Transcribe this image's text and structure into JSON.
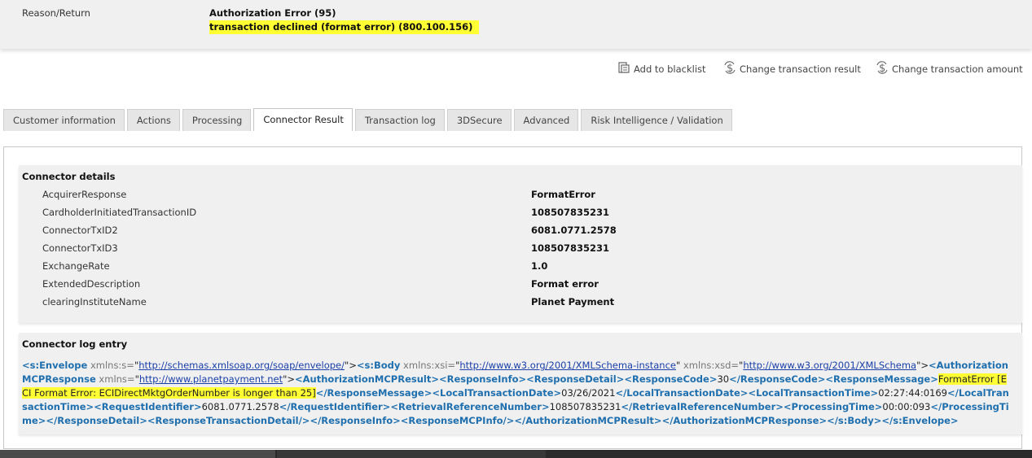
{
  "reason": {
    "label": "Reason/Return",
    "title": "Authorization Error (95)",
    "detail": "transaction declined (format error) (800.100.156)"
  },
  "actions": {
    "blacklist": {
      "label": "Add to blacklist",
      "icon": "blacklist-icon"
    },
    "change_result": {
      "label": "Change transaction result",
      "icon": "dollar-change-icon"
    },
    "change_amount": {
      "label": "Change transaction amount",
      "icon": "dollar-change-icon"
    }
  },
  "tabs": [
    {
      "label": "Customer information"
    },
    {
      "label": "Actions"
    },
    {
      "label": "Processing"
    },
    {
      "label": "Connector Result",
      "active": true
    },
    {
      "label": "Transaction log"
    },
    {
      "label": "3DSecure"
    },
    {
      "label": "Advanced"
    },
    {
      "label": "Risk Intelligence / Validation"
    }
  ],
  "connector_details": {
    "title": "Connector details",
    "rows": [
      {
        "key": "AcquirerResponse",
        "value": "FormatError"
      },
      {
        "key": "CardholderInitiatedTransactionID",
        "value": "108507835231"
      },
      {
        "key": "ConnectorTxID2",
        "value": "6081.0771.2578"
      },
      {
        "key": "ConnectorTxID3",
        "value": "108507835231"
      },
      {
        "key": "ExchangeRate",
        "value": "1.0"
      },
      {
        "key": "ExtendedDescription",
        "value": "Format error"
      },
      {
        "key": "clearingInstituteName",
        "value": "Planet Payment"
      }
    ]
  },
  "connector_log": {
    "title": "Connector log entry",
    "tokens": [
      {
        "t": "tag",
        "v": "<s:Envelope"
      },
      {
        "t": "attr",
        "v": " xmlns:s="
      },
      {
        "t": "txt",
        "v": "\""
      },
      {
        "t": "link",
        "v": "http://schemas.xmlsoap.org/soap/envelope/"
      },
      {
        "t": "txt",
        "v": "\">"
      },
      {
        "t": "tag",
        "v": "<s:Body"
      },
      {
        "t": "attr",
        "v": " xmlns:xsi="
      },
      {
        "t": "txt",
        "v": "\""
      },
      {
        "t": "link",
        "v": "http://www.w3.org/2001/XMLSchema-instance"
      },
      {
        "t": "txt",
        "v": "\""
      },
      {
        "t": "attr",
        "v": " xmlns:xsd="
      },
      {
        "t": "txt",
        "v": "\""
      },
      {
        "t": "link",
        "v": "http://www.w3.org/2001/XMLSchema"
      },
      {
        "t": "txt",
        "v": "\">"
      },
      {
        "t": "tag",
        "v": "<AuthorizationMCPResponse"
      },
      {
        "t": "attr",
        "v": " xmlns="
      },
      {
        "t": "txt",
        "v": "\""
      },
      {
        "t": "link",
        "v": "http://www.planetpayment.net"
      },
      {
        "t": "txt",
        "v": "\">"
      },
      {
        "t": "tag",
        "v": "<AuthorizationMCPResult>"
      },
      {
        "t": "tag",
        "v": "<ResponseInfo>"
      },
      {
        "t": "tag",
        "v": "<ResponseDetail>"
      },
      {
        "t": "tag",
        "v": "<ResponseCode>"
      },
      {
        "t": "txt",
        "v": "30"
      },
      {
        "t": "tag",
        "v": "</ResponseCode>"
      },
      {
        "t": "tag",
        "v": "<ResponseMessage>"
      },
      {
        "t": "hl",
        "v": "FormatError [ECI Format Error: ECIDirectMktgOrderNumber is longer than 25]"
      },
      {
        "t": "tag",
        "v": "</ResponseMessage>"
      },
      {
        "t": "tag",
        "v": "<LocalTransactionDate>"
      },
      {
        "t": "txt",
        "v": "03/26/2021"
      },
      {
        "t": "tag",
        "v": "</LocalTransactionDate>"
      },
      {
        "t": "tag",
        "v": "<LocalTransactionTime>"
      },
      {
        "t": "txt",
        "v": "02:27:44:0169"
      },
      {
        "t": "tag",
        "v": "</LocalTransactionTime>"
      },
      {
        "t": "tag",
        "v": "<RequestIdentifier>"
      },
      {
        "t": "txt",
        "v": "6081.0771.2578"
      },
      {
        "t": "tag",
        "v": "</RequestIdentifier>"
      },
      {
        "t": "tag",
        "v": "<RetrievalReferenceNumber>"
      },
      {
        "t": "txt",
        "v": "108507835231"
      },
      {
        "t": "tag",
        "v": "</RetrievalReferenceNumber>"
      },
      {
        "t": "tag",
        "v": "<ProcessingTime>"
      },
      {
        "t": "txt",
        "v": "00:00:093"
      },
      {
        "t": "tag",
        "v": "</ProcessingTime>"
      },
      {
        "t": "tag",
        "v": "</ResponseDetail>"
      },
      {
        "t": "tag",
        "v": "<ResponseTransactionDetail/>"
      },
      {
        "t": "tag",
        "v": "</ResponseInfo>"
      },
      {
        "t": "tag",
        "v": "<ResponseMCPInfo/>"
      },
      {
        "t": "tag",
        "v": "</AuthorizationMCPResult>"
      },
      {
        "t": "tag",
        "v": "</AuthorizationMCPResponse>"
      },
      {
        "t": "tag",
        "v": "</s:Body>"
      },
      {
        "t": "tag",
        "v": "</s:Envelope>"
      }
    ]
  },
  "colors": {
    "highlight": "#ffff33",
    "tag": "#1f6fae",
    "link": "#1a3fa8",
    "panel": "#f0f0f0"
  }
}
